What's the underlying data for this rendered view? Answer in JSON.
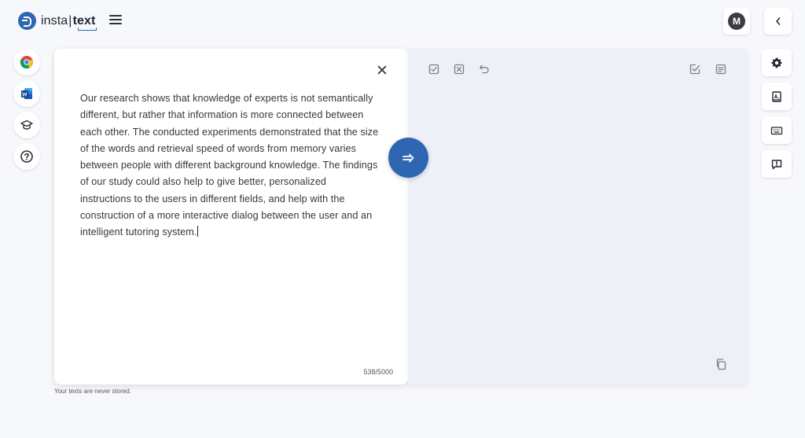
{
  "brand": {
    "name_left": "insta",
    "name_right": "text"
  },
  "user": {
    "initial": "M"
  },
  "left_rail": {
    "items": [
      {
        "icon": "chrome-icon"
      },
      {
        "icon": "word-icon"
      },
      {
        "icon": "graduation-cap-icon"
      },
      {
        "icon": "help-icon"
      }
    ]
  },
  "editor": {
    "text": "Our research shows that knowledge of experts is not semantically different, but rather that information is more connected between each other. The conducted experiments demonstrated that the size of the words and retrieval speed of words from memory varies between people with different background knowledge. The findings of our study could also help to give better, personalized instructions to the users in different fields, and help with the construction of a more interactive dialog between the user and an intelligent tutoring system.",
    "char_count": "538/5000"
  },
  "output_toolbar": {
    "icons": [
      "accept-all-icon",
      "reject-all-icon",
      "undo-icon",
      "check-list-icon",
      "notes-icon",
      "copy-icon"
    ]
  },
  "right_rail": {
    "items": [
      {
        "icon": "settings-icon"
      },
      {
        "icon": "dictionary-icon"
      },
      {
        "icon": "keyboard-icon"
      },
      {
        "icon": "feedback-icon"
      }
    ]
  },
  "footer": {
    "note": "Your texts are never stored."
  },
  "colors": {
    "brand_blue": "#2f66b2",
    "output_bg": "#eef0f8",
    "page_bg": "#f7f8fc"
  }
}
